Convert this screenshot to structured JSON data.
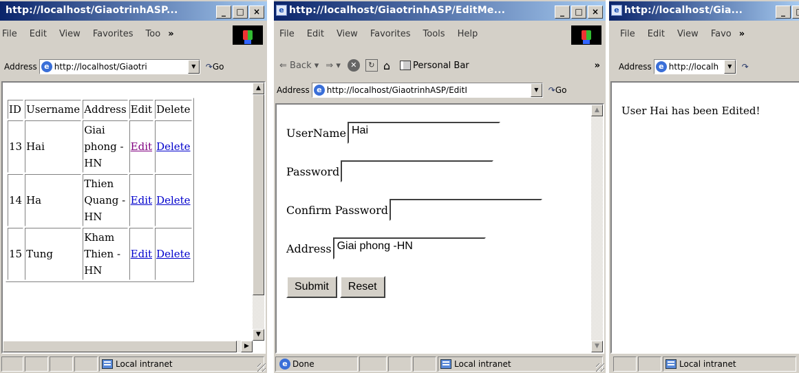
{
  "window1": {
    "title": "http://localhost/GiaotrinhASP...",
    "menu": [
      "File",
      "Edit",
      "View",
      "Favorites",
      "Too"
    ],
    "menu_more": "»",
    "address_label": "Address",
    "url": "http://localhost/Giaotri",
    "go_label": "Go",
    "table_headers": [
      "ID",
      "Username",
      "Address",
      "Edit",
      "Delete"
    ],
    "rows": [
      {
        "id": "13",
        "username": "Hai",
        "address": [
          "Giai",
          "phong -",
          "HN"
        ],
        "edit": "Edit",
        "delete": "Delete"
      },
      {
        "id": "14",
        "username": "Ha",
        "address": [
          "Thien",
          "Quang -",
          "HN"
        ],
        "edit": "Edit",
        "delete": "Delete"
      },
      {
        "id": "15",
        "username": "Tung",
        "address": [
          "Kham",
          "Thien -",
          "HN"
        ],
        "edit": "Edit",
        "delete": "Delete"
      }
    ],
    "status_zone": "Local intranet"
  },
  "window2": {
    "title": "http://localhost/GiaotrinhASP/EditMe...",
    "menu": [
      "File",
      "Edit",
      "View",
      "Favorites",
      "Tools",
      "Help"
    ],
    "toolbar": {
      "back": "Back",
      "personal_bar": "Personal Bar",
      "more": "»"
    },
    "address_label": "Address",
    "url": "http://localhost/GiaotrinhASP/EditI",
    "go_label": "Go",
    "form": {
      "username_label": "UserName",
      "username_value": "Hai",
      "password_label": "Password",
      "password_value": "",
      "confirm_label": "Confirm Password",
      "confirm_value": "",
      "address_label": "Address",
      "address_value": "Giai phong -HN",
      "submit_label": "Submit",
      "reset_label": "Reset"
    },
    "status_text": "Done",
    "status_zone": "Local intranet"
  },
  "window3": {
    "title": "http://localhost/Gia...",
    "menu": [
      "File",
      "Edit",
      "View",
      "Favo"
    ],
    "menu_more": "»",
    "address_label": "Address",
    "url": "http://localh",
    "message": "User Hai has been Edited!",
    "status_zone": "Local intranet"
  }
}
